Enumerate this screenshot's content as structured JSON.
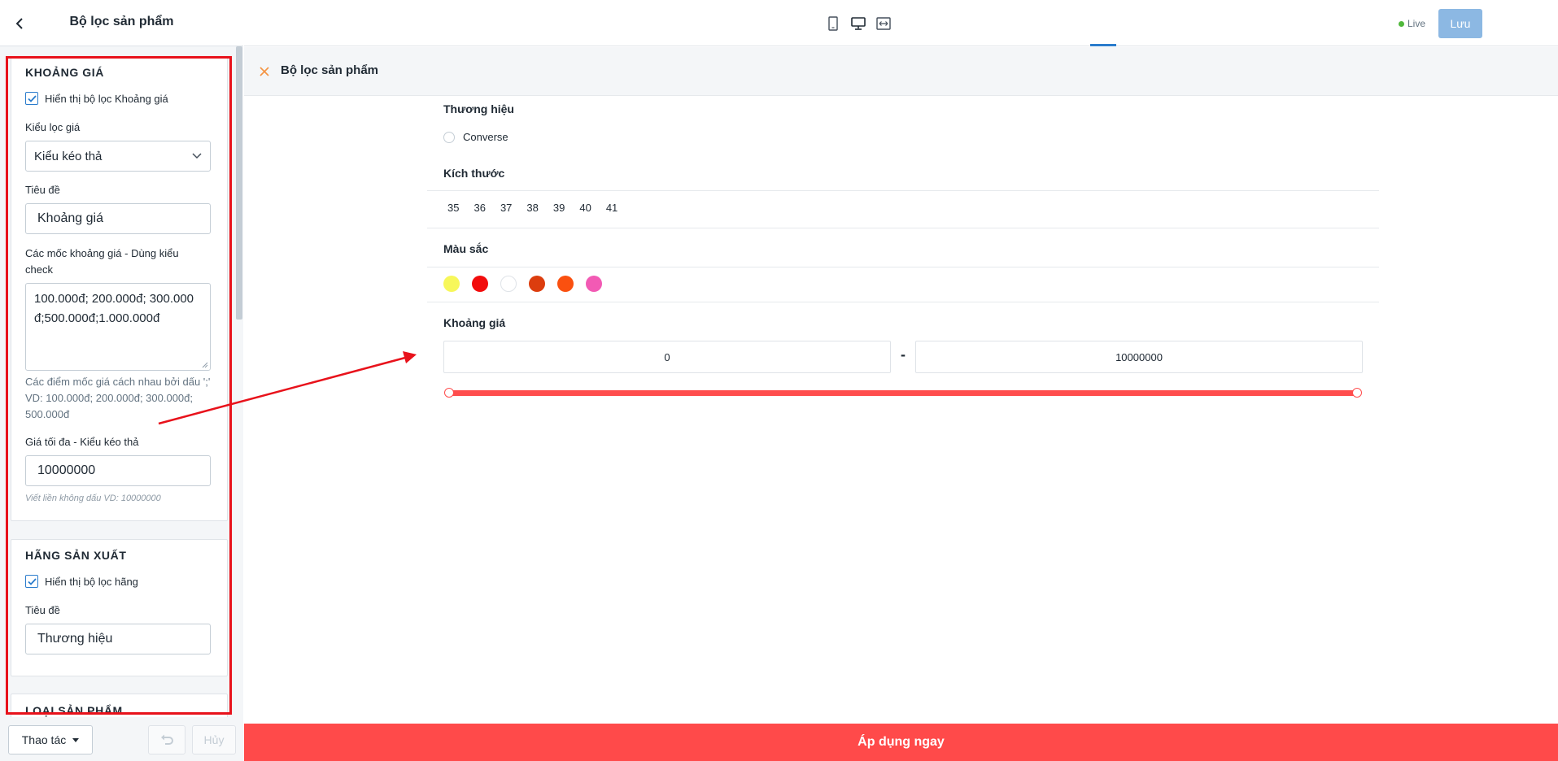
{
  "sidebar": {
    "title": "Bộ lọc sản phẩm",
    "price_panel": {
      "heading": "KHOẢNG GIÁ",
      "show_label": "Hiển thị bộ lọc Khoảng giá",
      "show_checked": true,
      "filter_type_label": "Kiểu lọc giá",
      "filter_type_value": "Kiểu kéo thả",
      "title_label": "Tiêu đề",
      "title_value": "Khoảng giá",
      "milestones_label": "Các mốc khoảng giá - Dùng kiểu check",
      "milestones_value": "100.000đ; 200.000đ; 300.000đ;500.000đ;1.000.000đ",
      "milestones_hint": "Các điểm mốc giá cách nhau bởi dấu ';' VD: 100.000đ; 200.000đ; 300.000đ; 500.000đ",
      "max_label": "Giá tối đa - Kiểu kéo thả",
      "max_value": "10000000",
      "max_hint": "Viết liền không dấu VD: 10000000"
    },
    "brand_panel": {
      "heading": "HÃNG SẢN XUẤT",
      "show_label": "Hiển thị bộ lọc hãng",
      "show_checked": true,
      "title_label": "Tiêu đề",
      "title_value": "Thương hiệu"
    },
    "type_panel": {
      "heading": "LOẠI SẢN PHẨM"
    },
    "footer": {
      "actions_label": "Thao tác",
      "cancel_label": "Hủy"
    }
  },
  "topbar": {
    "live_label": "Live",
    "save_label": "Lưu"
  },
  "preview": {
    "filter_title": "Bộ lọc sản phẩm",
    "brand": {
      "title": "Thương hiệu",
      "options": [
        "Converse"
      ]
    },
    "size": {
      "title": "Kích thước",
      "options": [
        "35",
        "36",
        "37",
        "38",
        "39",
        "40",
        "41"
      ]
    },
    "color": {
      "title": "Màu sắc",
      "swatches": [
        "#f7f75a",
        "#f20c0c",
        "#ffffff",
        "#dc3d0e",
        "#fa500f",
        "#f25ab4"
      ]
    },
    "price": {
      "title": "Khoảng giá",
      "min": "0",
      "max": "10000000",
      "dash": "-",
      "slider_min_fraction": 0,
      "slider_max_fraction": 1
    },
    "apply_label": "Áp dụng ngay"
  },
  "colors": {
    "accent": "#2a7ccc",
    "apply": "#ff4a4a",
    "annotation": "#e8121b"
  }
}
